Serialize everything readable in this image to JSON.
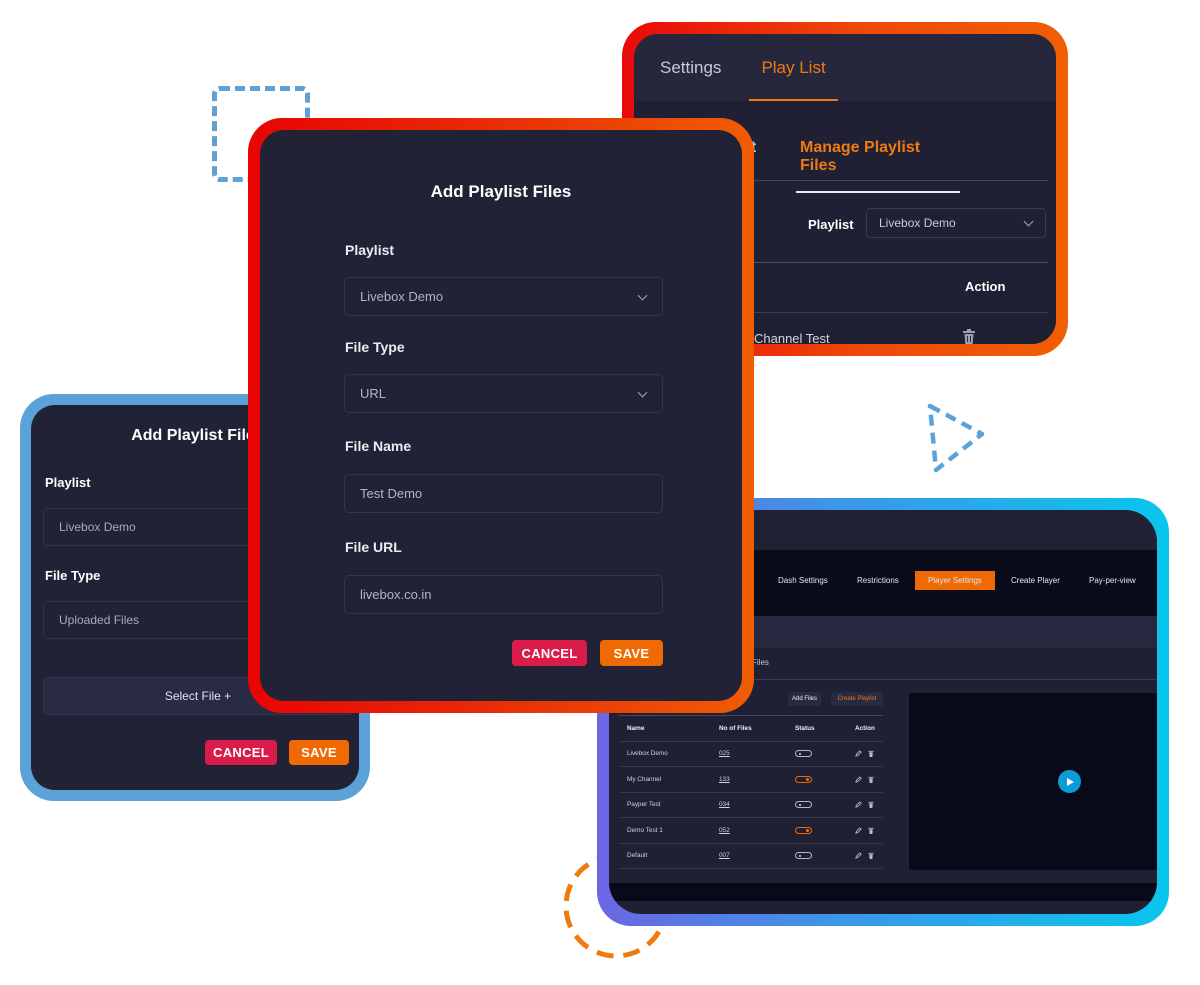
{
  "colors": {
    "accent_orange": "#f06a04",
    "cancel_red": "#d91c4a",
    "panel_bg": "#212235",
    "frame_blue": "#5aa2d8",
    "play_blue": "#0d9bd6"
  },
  "playlist_card": {
    "tabs": [
      {
        "label": "Settings",
        "active": false
      },
      {
        "label": "Play List",
        "active": true
      }
    ],
    "subtabs": [
      {
        "label": "st",
        "active": false
      },
      {
        "label": "Manage Playlist Files",
        "active": true
      }
    ],
    "playlist_label": "Playlist",
    "playlist_value": "Livebox Demo",
    "table_header_action": "Action",
    "rows": [
      {
        "name": "Channel Test"
      }
    ]
  },
  "upload_dialog": {
    "title": "Add Playlist File",
    "playlist_label": "Playlist",
    "playlist_value": "Livebox Demo",
    "file_type_label": "File Type",
    "file_type_value": "Uploaded Files",
    "select_file_label": "Select File  +",
    "cancel_label": "CANCEL",
    "save_label": "SAVE"
  },
  "url_dialog": {
    "title": "Add Playlist Files",
    "playlist_label": "Playlist",
    "playlist_value": "Livebox Demo",
    "file_type_label": "File Type",
    "file_type_value": "URL",
    "file_name_label": "File Name",
    "file_name_value": "Test Demo",
    "file_url_label": "File URL",
    "file_url_value": "livebox.co.in",
    "cancel_label": "CANCEL",
    "save_label": "SAVE"
  },
  "player_card": {
    "nav": [
      {
        "label": "Dash Settings",
        "active": false
      },
      {
        "label": "Restrictions",
        "active": false
      },
      {
        "label": "Player Settings",
        "active": true
      },
      {
        "label": "Create Player",
        "active": false
      },
      {
        "label": "Pay-per-view",
        "active": false
      }
    ],
    "breadcrumb": "Files",
    "add_files_label": "Add Files",
    "create_playlist_label": "Create Playlist",
    "table": {
      "headers": [
        "Name",
        "No of Files",
        "Status",
        "Action"
      ],
      "rows": [
        {
          "name": "Livebox Demo",
          "files": "025",
          "status_on": false
        },
        {
          "name": "My Channel",
          "files": "133",
          "status_on": true
        },
        {
          "name": "Payper Test",
          "files": "034",
          "status_on": false
        },
        {
          "name": "Demo Test 1",
          "files": "052",
          "status_on": true
        },
        {
          "name": "Default",
          "files": "007",
          "status_on": false
        }
      ]
    }
  }
}
